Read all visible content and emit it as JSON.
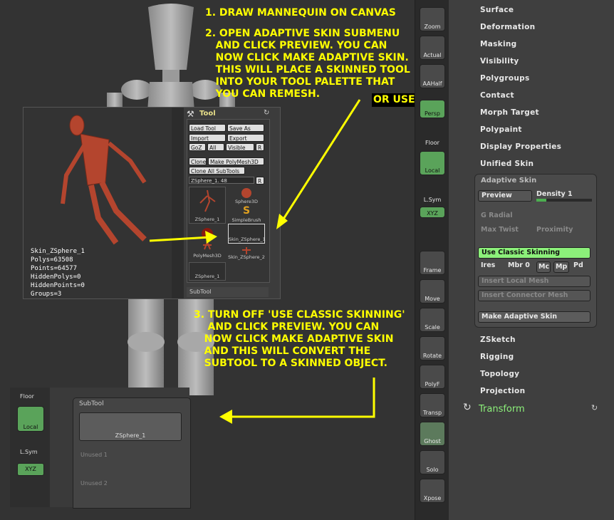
{
  "instructions": {
    "step1": "1. DRAW MANNEQUIN ON CANVAS",
    "step2": "2. OPEN ADAPTIVE SKIN SUBMENU\n   AND CLICK PREVIEW. YOU CAN\n   NOW CLICK MAKE ADAPTIVE SKIN.\n   THIS WILL PLACE A SKINNED TOOL\n   INTO YOUR TOOL PALETTE THAT\n   YOU CAN REMESH.",
    "or_use": "OR USE AS IS",
    "step3": "3. TURN OFF 'USE CLASSIC SKINNING'\n    AND CLICK PREVIEW. YOU CAN\n   NOW CLICK MAKE ADAPTIVE SKIN\n   AND THIS WILL CONVERT THE\n   SUBTOOL TO A SKINNED OBJECT."
  },
  "preview_stats": "Skin_ZSphere_1\nPolys=63508\nPoints=64577\nHiddenPolys=0\nHiddenPoints=0\nGroups=3",
  "tool_palette": {
    "title": "Tool",
    "load_tool": "Load Tool",
    "save_as": "Save As",
    "import": "Import",
    "export": "Export",
    "goz": "GoZ",
    "all": "All",
    "visible": "Visible",
    "r": "R",
    "clone": "Clone",
    "make_polymesh": "Make PolyMesh3D",
    "clone_all": "Clone All SubTools",
    "zsphere_slider": "ZSphere_1. 48",
    "thumbs": [
      "ZSphere_1",
      "Sphere3D",
      "SimpleBrush",
      "PolyMesh3D",
      "Skin_ZSphere_1",
      "Skin_ZSphere_2",
      "ZSphere_1"
    ],
    "subtool_label": "SubTool"
  },
  "subtool_panel": {
    "floor": "Floor",
    "local": "Local",
    "lsym": "L.Sym",
    "xyz": "XYZ",
    "title": "SubTool",
    "active": "ZSphere_1",
    "unused1": "Unused 1",
    "unused2": "Unused 2"
  },
  "dock": [
    "Zoom",
    "Actual",
    "AAHalf",
    "Persp",
    "Floor",
    "Local",
    "L.Sym",
    "XYZ",
    "Frame",
    "Move",
    "Scale",
    "Rotate",
    "PolyF",
    "Transp",
    "Ghost",
    "Solo",
    "Xpose"
  ],
  "menu_items_top": [
    "Surface",
    "Deformation",
    "Masking",
    "Visibility",
    "Polygroups",
    "Contact",
    "Morph Target",
    "Polypaint",
    "Display Properties",
    "Unified Skin"
  ],
  "adaptive_skin": {
    "title": "Adaptive Skin",
    "preview": "Preview",
    "density": "Density 1",
    "g_radial": "G Radial",
    "max_twist": "Max Twist",
    "proximity": "Proximity",
    "use_classic": "Use Classic Skinning",
    "ires": "Ires",
    "mbr": "Mbr 0",
    "mc": "Mc",
    "mp": "Mp",
    "pd": "Pd",
    "insert_local": "Insert Local Mesh",
    "insert_connector": "Insert Connector Mesh",
    "make_adaptive": "Make Adaptive Skin"
  },
  "menu_items_bottom": [
    "ZSketch",
    "Rigging",
    "Topology",
    "Projection"
  ],
  "transform": "Transform",
  "colors": {
    "instruction_yellow": "#ffff00",
    "active_green": "#5aa35a",
    "highlight_green": "#8cf07a"
  }
}
